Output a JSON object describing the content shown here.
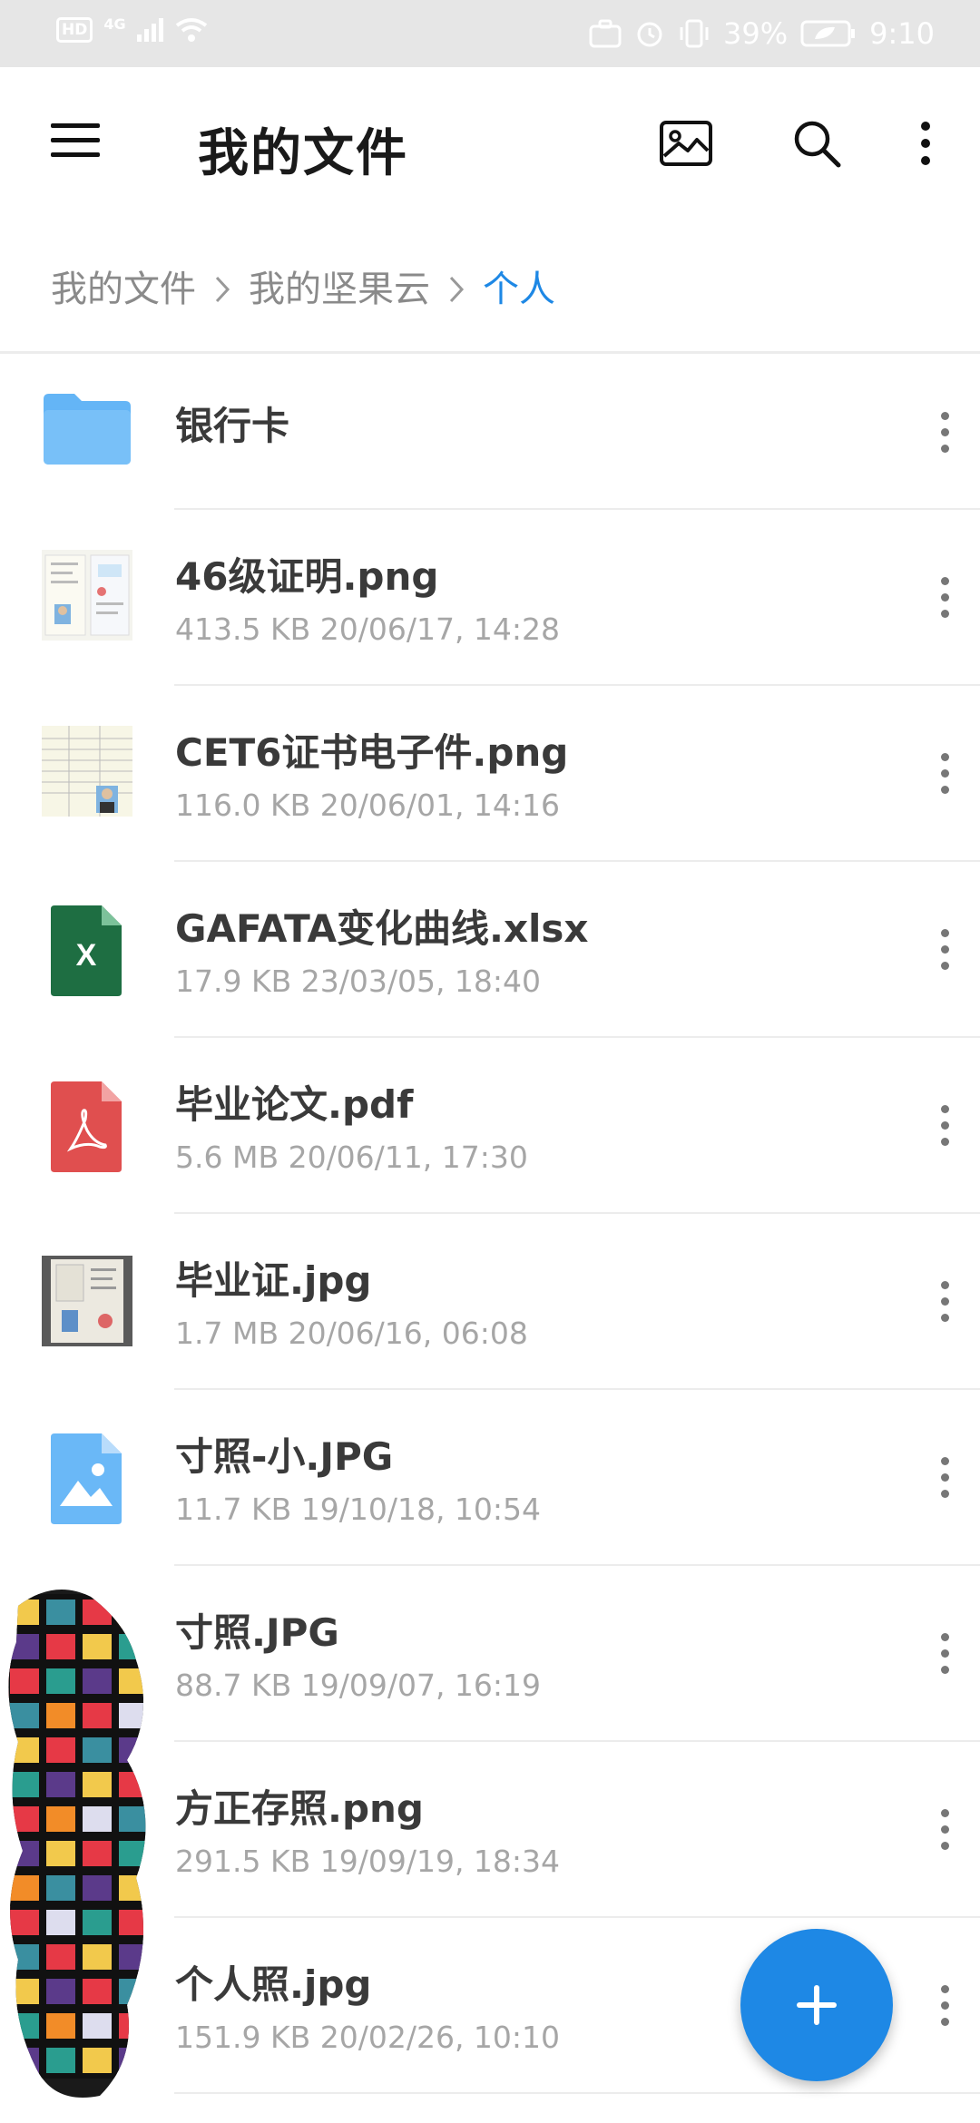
{
  "status_bar": {
    "hd": "HD",
    "network": "4G",
    "battery": "39%",
    "time": "9:10"
  },
  "app_bar": {
    "title": "我的文件",
    "icons": [
      "menu-icon",
      "image-icon",
      "search-icon",
      "more-vert-icon"
    ]
  },
  "breadcrumb": {
    "items": [
      "我的文件",
      "我的坚果云",
      "个人"
    ]
  },
  "files": [
    {
      "name": "银行卡",
      "type": "folder",
      "meta": ""
    },
    {
      "name": "46级证明.png",
      "type": "image-thumb",
      "meta": "413.5 KB 20/06/17, 14:28"
    },
    {
      "name": "CET6证书电子件.png",
      "type": "image-thumb",
      "meta": "116.0 KB 20/06/01, 14:16"
    },
    {
      "name": "GAFATA变化曲线.xlsx",
      "type": "excel",
      "meta": "17.9 KB 23/03/05, 18:40"
    },
    {
      "name": "毕业论文.pdf",
      "type": "pdf",
      "meta": "5.6 MB 20/06/11, 17:30"
    },
    {
      "name": "毕业证.jpg",
      "type": "photo-thumb",
      "meta": "1.7 MB 20/06/16, 06:08"
    },
    {
      "name": "寸照-小.JPG",
      "type": "image",
      "meta": "11.7 KB 19/10/18, 10:54"
    },
    {
      "name": "寸照.JPG",
      "type": "image",
      "meta": "88.7 KB 19/09/07, 16:19"
    },
    {
      "name": "方正存照.png",
      "type": "image",
      "meta": "291.5 KB 19/09/19, 18:34"
    },
    {
      "name": "个人照.jpg",
      "type": "image",
      "meta": "151.9 KB 20/02/26, 10:10"
    }
  ],
  "fab": {
    "icon": "plus-icon"
  },
  "colors": {
    "accent": "#1e88e5",
    "folder": "#64b5f6",
    "excel": "#1e6e42",
    "pdf": "#e04f4f",
    "image": "#6ab8f7"
  }
}
